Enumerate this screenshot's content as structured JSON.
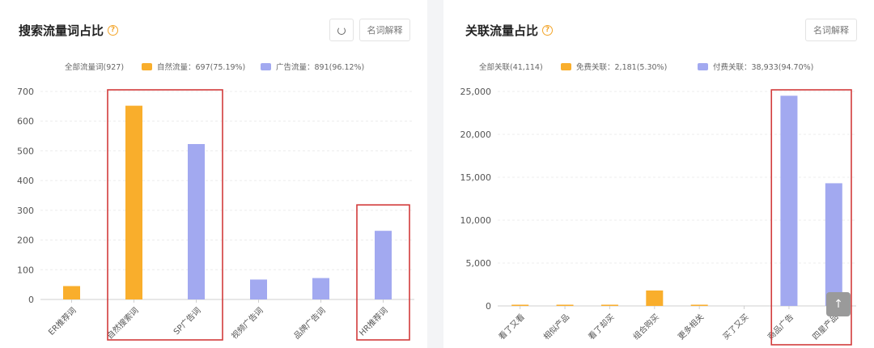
{
  "left": {
    "title": "搜索流量词占比",
    "help_icon": "?",
    "buttons": {
      "glossary": "名词解释"
    },
    "legend": {
      "total": "全部流量词(927)",
      "natural": "自然流量：697(75.19%)",
      "ad": "广告流量：891(96.12%)"
    }
  },
  "right": {
    "title": "关联流量占比",
    "help_icon": "?",
    "buttons": {
      "glossary": "名词解释"
    },
    "legend": {
      "total": "全部关联(41,114)",
      "free": "免费关联：2,181(5.30%)",
      "paid": "付费关联：38,933(94.70%)"
    }
  },
  "colors": {
    "orange": "#f9ae2c",
    "blue": "#a2a9f0",
    "highlight": "#d23b3b"
  },
  "icons": {
    "refresh": "refresh-icon",
    "scroll_top": "arrow-up-icon"
  },
  "chart_data": [
    {
      "type": "bar",
      "title": "搜索流量词占比",
      "categories": [
        "ER推荐词",
        "自然搜索词",
        "SP广告词",
        "视频广告词",
        "品牌广告词",
        "HR推荐词"
      ],
      "values": [
        45,
        652,
        523,
        67,
        72,
        231
      ],
      "series_of_bar": [
        "orange",
        "orange",
        "blue",
        "blue",
        "blue",
        "blue"
      ],
      "yticks": [
        0,
        100,
        200,
        300,
        400,
        500,
        600,
        700
      ],
      "ytick_labels": [
        "0",
        "100",
        "200",
        "300",
        "400",
        "500",
        "600",
        "700"
      ],
      "ylim": [
        0,
        700
      ],
      "highlighted_categories": [
        [
          1,
          2
        ],
        [
          5,
          5
        ]
      ]
    },
    {
      "type": "bar",
      "title": "关联流量占比",
      "categories": [
        "看了又看",
        "相似产品",
        "看了却买",
        "组合购买",
        "更多相关",
        "买了又买",
        "商品广告",
        "四星产品"
      ],
      "values": [
        120,
        40,
        130,
        1800,
        60,
        0,
        24500,
        14300
      ],
      "series_of_bar": [
        "orange",
        "orange",
        "orange",
        "orange",
        "orange",
        "orange",
        "blue",
        "blue"
      ],
      "yticks": [
        0,
        5000,
        10000,
        15000,
        20000,
        25000
      ],
      "ytick_labels": [
        "0",
        "5,000",
        "10,000",
        "15,000",
        "20,000",
        "25,000"
      ],
      "ylim": [
        0,
        25000
      ],
      "highlighted_categories": [
        [
          6,
          7
        ]
      ]
    }
  ]
}
